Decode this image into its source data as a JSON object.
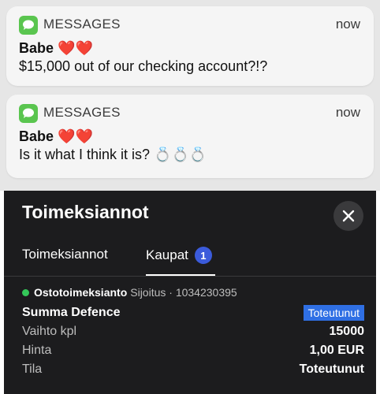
{
  "notifications": [
    {
      "app": "MESSAGES",
      "time": "now",
      "sender": "Babe",
      "sender_emoji": "❤️❤️",
      "body": "$15,000 out of our checking account?!?"
    },
    {
      "app": "MESSAGES",
      "time": "now",
      "sender": "Babe",
      "sender_emoji": "❤️❤️",
      "body": "Is it what I think it is? 💍💍💍"
    }
  ],
  "panel": {
    "title": "Toimeksiannot",
    "close_icon": "close-icon",
    "tabs": [
      {
        "label": "Toimeksiannot"
      },
      {
        "label": "Kaupat",
        "badge": "1"
      }
    ],
    "order": {
      "type": "Ostotoimeksianto",
      "meta": "Sijoitus · 1034230395",
      "status_color": "#34c759",
      "rows": [
        {
          "label": "Summa Defence",
          "value": "Toteutunut"
        },
        {
          "label": "Vaihto kpl",
          "value": "15000"
        },
        {
          "label": "Hinta",
          "value": "1,00 EUR"
        },
        {
          "label": "Tila",
          "value": "Toteutunut"
        }
      ]
    }
  },
  "colors": {
    "accent_blue": "#2f6fe4",
    "messages_green": "#5ac54f",
    "panel_bg": "#1c1c1e"
  }
}
